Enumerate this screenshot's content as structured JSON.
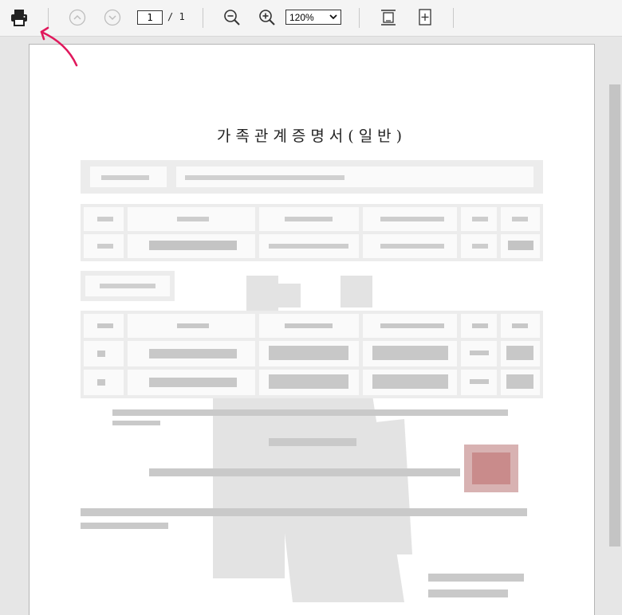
{
  "toolbar": {
    "icons": [
      "printer-icon",
      "chevron-up-icon",
      "chevron-down-icon",
      "zoom-out-icon",
      "zoom-in-icon",
      "fit-page-icon",
      "fit-width-icon"
    ],
    "page_current": "1",
    "page_total": "/ 1",
    "zoom_value": "120%",
    "colors": {
      "annotation_arrow": "#e0185c"
    }
  },
  "document": {
    "title": "가족관계증명서(일반)",
    "stamp_color": "#c98b8b"
  }
}
